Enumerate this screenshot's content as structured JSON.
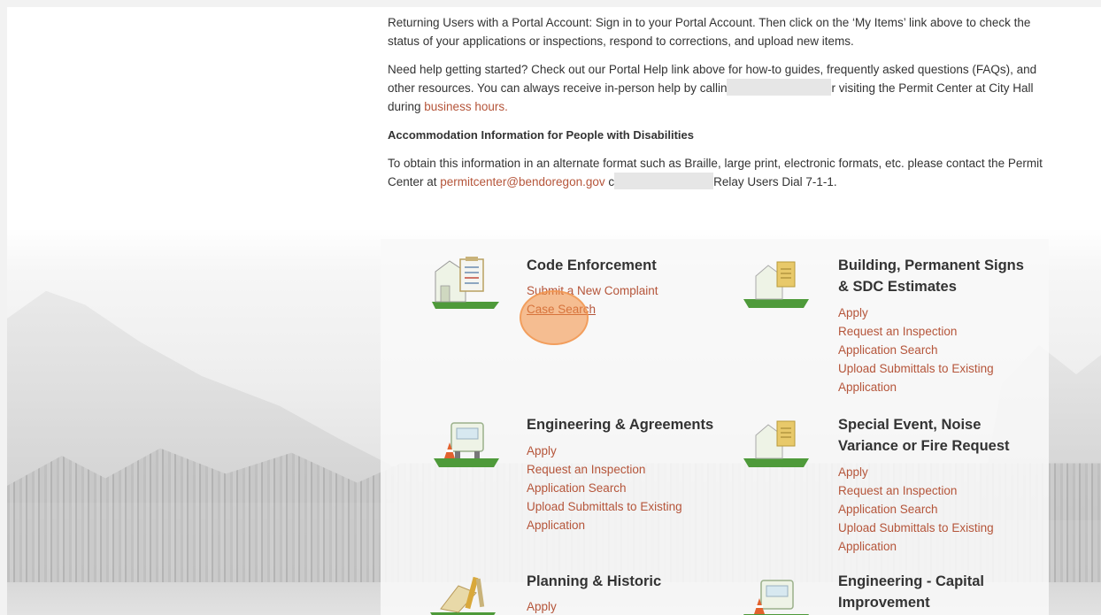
{
  "intro": {
    "returning_users": "Returning Users with a Portal Account: Sign in to your Portal Account. Then click on the ‘My Items’ link above to check the status of your applications or inspections, respond to corrections, and upload new items.",
    "help_text_1": "Need help getting started? Check out our Portal Help link above for how-to guides, frequently asked questions (FAQs), and other resources. You can always receive in-person help by callin",
    "help_text_2": "r visiting the Permit Center at City Hall during ",
    "business_hours_link": "business hours.",
    "accommodation_heading": "Accommodation Information for People with Disabilities",
    "accommodation_text_1": "To obtain this information in an alternate format such as Braille, large print, electronic formats, etc. please contact the Permit Center at ",
    "permit_email": "permitcenter@bendoregon.gov",
    "accommodation_text_2": " c",
    "accommodation_text_3": "Relay Users Dial 7-1-1."
  },
  "services": {
    "code_enforcement": {
      "title": "Code Enforcement",
      "links": [
        "Submit a New Complaint",
        "Case Search"
      ],
      "icon": "code-enforcement-icon"
    },
    "building": {
      "title_line1": "Building, Permanent Signs",
      "title_line2": "& SDC Estimates",
      "links": [
        "Apply",
        "Request an Inspection",
        "Application Search",
        "Upload Submittals to Existing",
        "Application"
      ],
      "icon": "building-icon"
    },
    "engineering": {
      "title": "Engineering & Agreements",
      "links": [
        "Apply",
        "Request an Inspection",
        "Application Search",
        "Upload Submittals to Existing",
        "Application"
      ],
      "icon": "engineering-icon"
    },
    "special_event": {
      "title_line1": "Special Event, Noise",
      "title_line2": "Variance or Fire Request",
      "links": [
        "Apply",
        "Request an Inspection",
        "Application Search",
        "Upload Submittals to Existing",
        "Application"
      ],
      "icon": "special-event-icon"
    },
    "planning": {
      "title": "Planning & Historic",
      "links": [
        "Apply"
      ],
      "icon": "planning-icon"
    },
    "capital": {
      "title_line1": "Engineering - Capital",
      "title_line2": "Improvement",
      "icon": "capital-improvement-icon"
    }
  },
  "colors": {
    "link": "#b5553a",
    "text": "#333333",
    "icon_green": "#4e9a3a",
    "highlight": "#f38c3c"
  }
}
